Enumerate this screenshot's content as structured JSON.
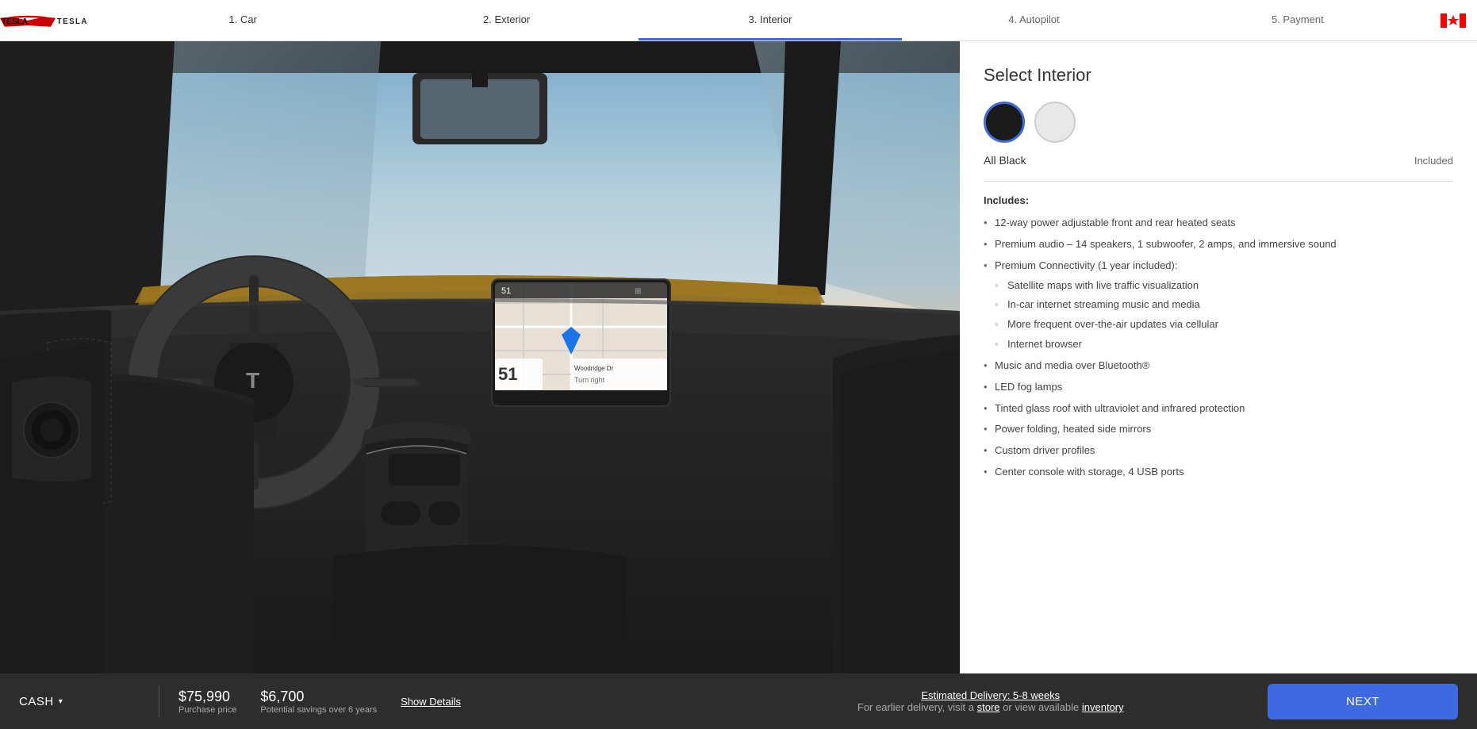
{
  "header": {
    "logo_label": "Tesla",
    "steps": [
      {
        "id": "car",
        "label": "1. Car",
        "state": "completed"
      },
      {
        "id": "exterior",
        "label": "2. Exterior",
        "state": "completed"
      },
      {
        "id": "interior",
        "label": "3. Interior",
        "state": "active"
      },
      {
        "id": "autopilot",
        "label": "4. Autopilot",
        "state": "inactive"
      },
      {
        "id": "payment",
        "label": "5. Payment",
        "state": "inactive"
      }
    ]
  },
  "right_panel": {
    "title": "Select Interior",
    "swatches": [
      {
        "id": "all-black",
        "label": "All Black",
        "selected": true
      },
      {
        "id": "white",
        "label": "White Interior",
        "selected": false
      }
    ],
    "selected_label": "All Black",
    "selected_price": "Included",
    "includes_heading": "Includes:",
    "includes_items": [
      "12-way power adjustable front and rear heated seats",
      "Premium audio – 14 speakers, 1 subwoofer, 2 amps, and immersive sound",
      "Premium Connectivity (1 year included):",
      "Music and media over Bluetooth®",
      "LED fog lamps",
      "Tinted glass roof with ultraviolet and infrared protection",
      "Power folding, heated side mirrors",
      "Custom driver profiles",
      "Center console with storage, 4 USB ports"
    ],
    "sub_items": [
      "Satellite maps with live traffic visualization",
      "In-car internet streaming music and media",
      "More frequent over-the-air updates via cellular",
      "Internet browser"
    ]
  },
  "footer": {
    "payment_type": "CASH",
    "purchase_price": "$75,990",
    "purchase_price_label": "Purchase price",
    "savings_amount": "$6,700",
    "savings_label": "Potential savings over 6 years",
    "show_details": "Show Details",
    "delivery_text": "Estimated Delivery: 5-8 weeks",
    "earlier_delivery_text": "For earlier delivery, visit a ",
    "store_link": "store",
    "or_text": " or view available ",
    "inventory_link": "inventory",
    "next_button": "NEXT"
  }
}
